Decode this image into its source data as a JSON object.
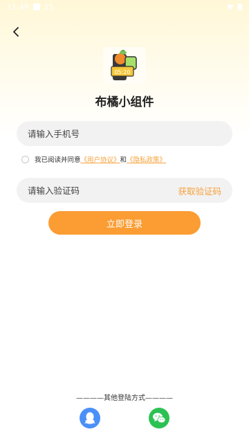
{
  "status_bar": {
    "time": "11:49",
    "notification": "15"
  },
  "app": {
    "name": "布橘小组件",
    "logo_clock": "05:20"
  },
  "phone_field": {
    "placeholder": "请输入手机号",
    "value": ""
  },
  "agreement": {
    "prefix": "我已阅读并同意",
    "user_agreement": "《用户协议》",
    "and": "和",
    "privacy_policy": "《隐私政策》",
    "checked": false
  },
  "code_field": {
    "placeholder": "请输入验证码",
    "value": "",
    "get_code_label": "获取验证码"
  },
  "login_button_label": "立即登录",
  "other_login": {
    "title": "————其他登陆方式————",
    "options": [
      {
        "icon": "qq-icon",
        "color": "#4a90f7"
      },
      {
        "icon": "wechat-icon",
        "color": "#2cc253"
      }
    ]
  },
  "colors": {
    "accent": "#f6a13b",
    "button": "#fb9d33",
    "field_bg": "#f2f2f2"
  }
}
